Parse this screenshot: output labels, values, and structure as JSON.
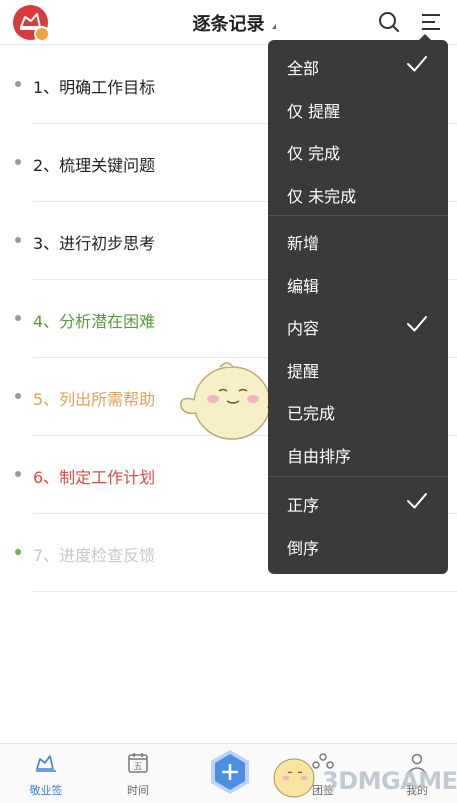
{
  "header": {
    "title": "逐条记录",
    "logo_icon": "app-logo-icon",
    "search_icon": "search-icon",
    "menu_icon": "menu-icon"
  },
  "items": [
    {
      "label": "1、明确工作目标",
      "color": "#222222",
      "dot": "#9a9a9a"
    },
    {
      "label": "2、梳理关键问题",
      "color": "#222222",
      "dot": "#9a9a9a"
    },
    {
      "label": "3、进行初步思考",
      "color": "#222222",
      "dot": "#9a9a9a"
    },
    {
      "label": "4、分析潜在困难",
      "color": "#5a9a3c",
      "dot": "#9a9a9a"
    },
    {
      "label": "5、列出所需帮助",
      "color": "#d9a55a",
      "dot": "#9a9a9a"
    },
    {
      "label": "6、制定工作计划",
      "color": "#d94a4a",
      "dot": "#9a9a9a"
    },
    {
      "label": "7、进度检查反馈",
      "color": "#c8c8c8",
      "dot": "#6ab04c"
    }
  ],
  "dropdown": {
    "groups": [
      [
        {
          "label": "全部",
          "checked": true
        },
        {
          "label": "仅 提醒",
          "checked": false
        },
        {
          "label": "仅 完成",
          "checked": false
        },
        {
          "label": "仅 未完成",
          "checked": false
        }
      ],
      [
        {
          "label": "新增",
          "checked": false
        },
        {
          "label": "编辑",
          "checked": false
        },
        {
          "label": "内容",
          "checked": true
        },
        {
          "label": "提醒",
          "checked": false
        },
        {
          "label": "已完成",
          "checked": false
        },
        {
          "label": "自由排序",
          "checked": false
        }
      ],
      [
        {
          "label": "正序",
          "checked": true
        },
        {
          "label": "倒序",
          "checked": false
        }
      ]
    ]
  },
  "tabbar": {
    "tabs": [
      {
        "label": "敬业签",
        "icon": "note-icon",
        "active": true
      },
      {
        "label": "时间",
        "icon": "calendar-icon",
        "active": false
      },
      {
        "label": "",
        "icon": "add-icon",
        "active": false
      },
      {
        "label": "团签",
        "icon": "team-icon",
        "active": false
      },
      {
        "label": "我的",
        "icon": "user-icon",
        "active": false
      }
    ],
    "calendar_day": "五"
  },
  "watermark": {
    "text": "3DMGAME"
  },
  "colors": {
    "accent": "#3b7fd6",
    "menu_bg": "#3a3a3a",
    "logo": "#d93a3a"
  }
}
